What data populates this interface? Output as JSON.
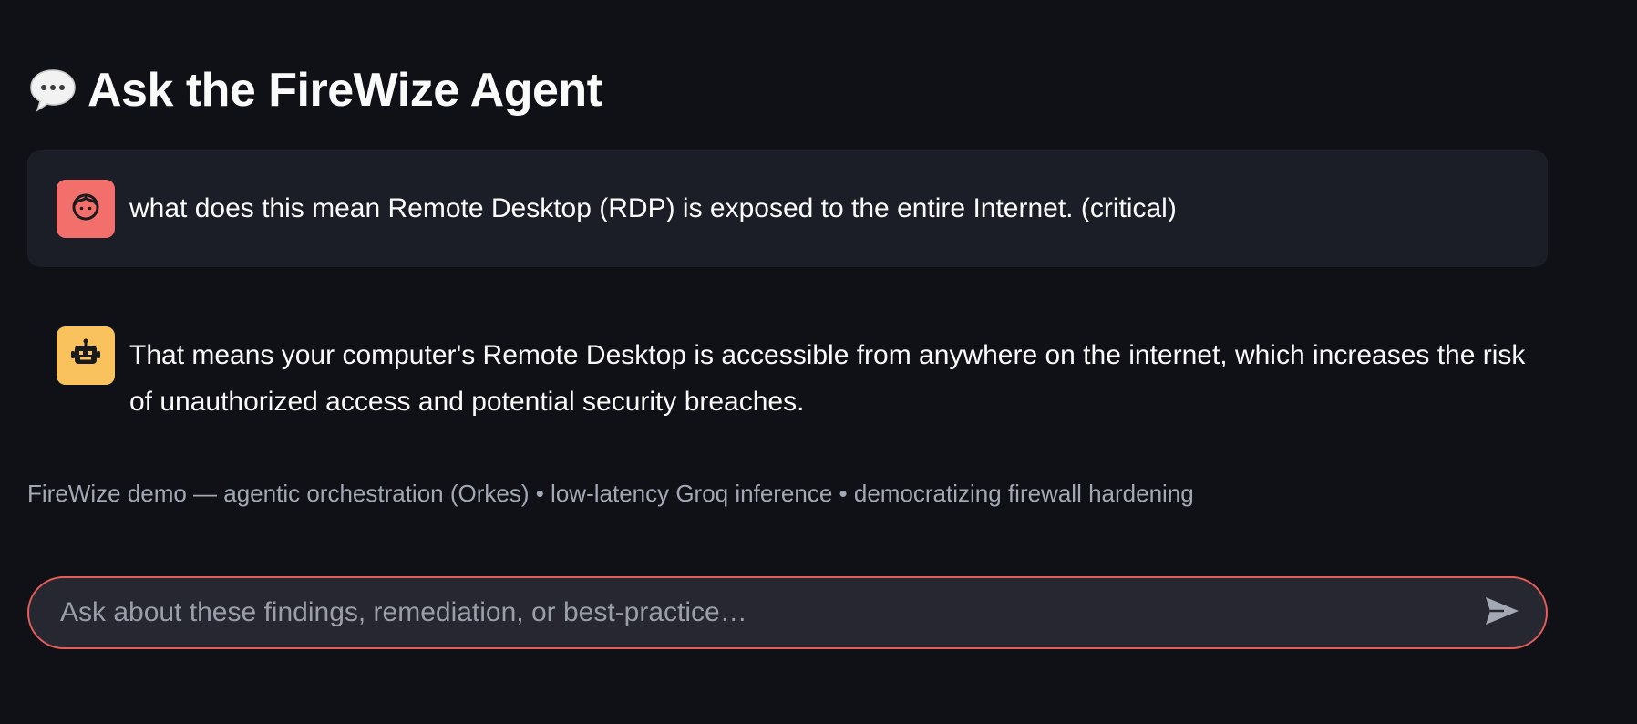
{
  "header": {
    "icon": "speech-bubble-icon",
    "title": "Ask the FireWize Agent"
  },
  "messages": [
    {
      "role": "user",
      "avatar_icon": "user-face-icon",
      "avatar_color": "#f36f6b",
      "text": "what does this mean Remote Desktop (RDP) is exposed to the entire Internet. (critical)"
    },
    {
      "role": "assistant",
      "avatar_icon": "robot-icon",
      "avatar_color": "#f9c25d",
      "text": "That means your computer's Remote Desktop is accessible from anywhere on the internet, which increases the risk of unauthorized access and potential security breaches."
    }
  ],
  "caption": "FireWize demo — agentic orchestration (Orkes) • low-latency Groq inference • democratizing firewall hardening",
  "chat_input": {
    "placeholder": "Ask about these findings, remediation, or best-practice…",
    "value": "",
    "send_icon": "send-arrow-icon",
    "border_color": "#e35f58"
  },
  "colors": {
    "background": "#0f1116",
    "user_message_bg": "#1b1e26",
    "caption": "#a3a8b4"
  }
}
